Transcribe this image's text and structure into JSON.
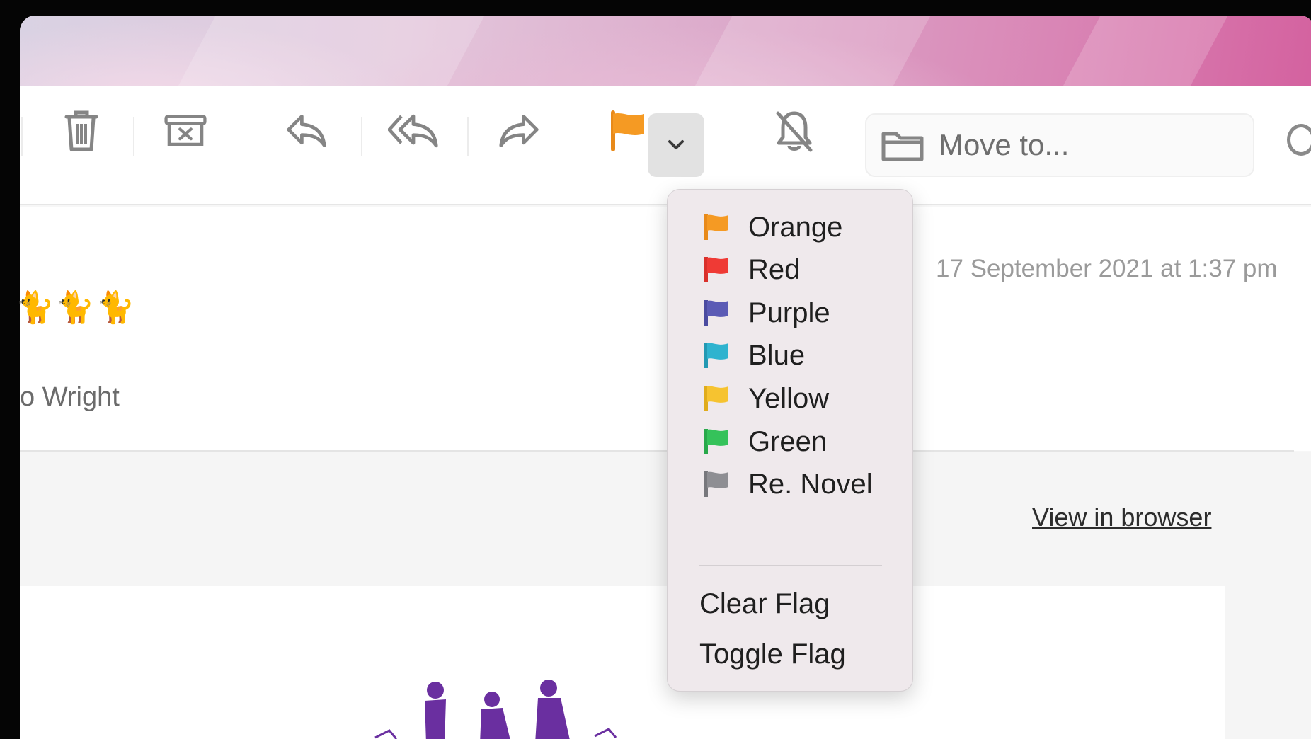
{
  "toolbar": {
    "buttons": [
      {
        "name": "trash-icon"
      },
      {
        "name": "junk-icon"
      },
      {
        "name": "reply-icon"
      },
      {
        "name": "reply-all-icon"
      },
      {
        "name": "forward-icon"
      },
      {
        "name": "flag-icon",
        "color": "#f59a23"
      },
      {
        "name": "chevron-down-icon"
      },
      {
        "name": "bell-slash-icon"
      }
    ],
    "move_to_label": "Move to..."
  },
  "message": {
    "emoji_row": "🐈🐈🐈",
    "sender": "o Wright",
    "date": "17 September 2021 at 1:37 pm",
    "view_in_browser": "View in browser"
  },
  "flag_menu": {
    "items": [
      {
        "label": "Orange",
        "color": "#f59a23"
      },
      {
        "label": "Red",
        "color": "#ef3a35"
      },
      {
        "label": "Purple",
        "color": "#5b5bb5"
      },
      {
        "label": "Blue",
        "color": "#2fb3cf"
      },
      {
        "label": "Yellow",
        "color": "#f6c330"
      },
      {
        "label": "Green",
        "color": "#35c25a"
      },
      {
        "label": "Re. Novel",
        "color": "#8e8e93"
      }
    ],
    "clear_flag": "Clear Flag",
    "toggle_flag": "Toggle Flag"
  }
}
